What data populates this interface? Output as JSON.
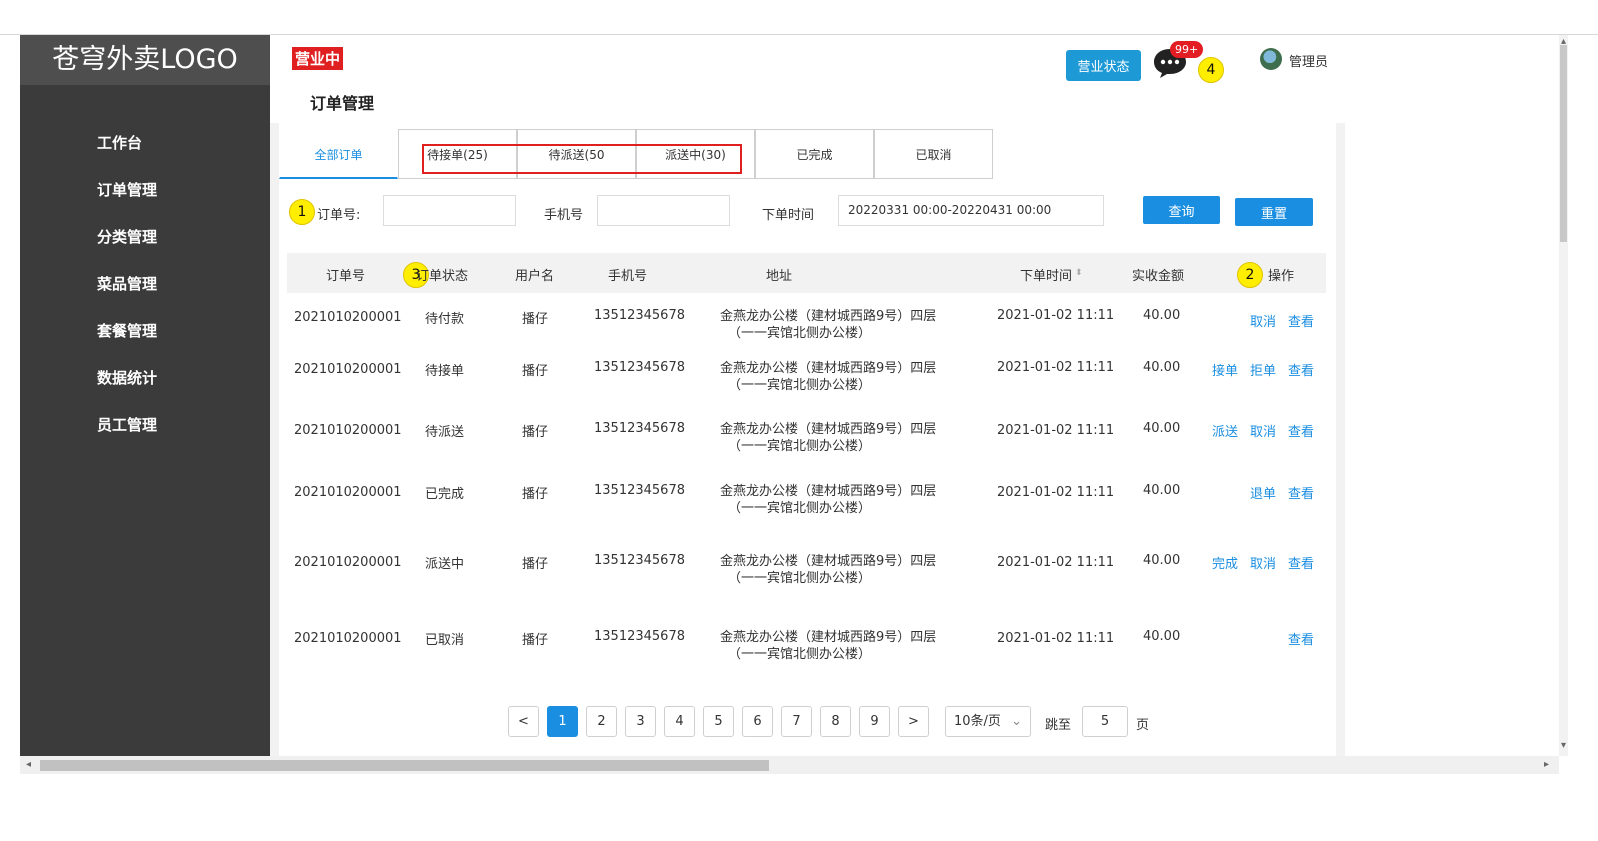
{
  "app": {
    "logo": "苍穹外卖LOGO"
  },
  "sidebar": {
    "items": [
      "工作台",
      "订单管理",
      "分类管理",
      "菜品管理",
      "套餐管理",
      "数据统计",
      "员工管理"
    ]
  },
  "header": {
    "business_status_badge": "营业中",
    "page_title": "订单管理",
    "status_button": "营业状态",
    "message_badge": "99+",
    "admin_name": "管理员"
  },
  "callouts": [
    "1",
    "2",
    "3",
    "4"
  ],
  "tabs": [
    "全部订单",
    "待接单(25)",
    "待派送(50",
    "派送中(30)",
    "已完成",
    "已取消"
  ],
  "filter": {
    "order_no_label": "订单号:",
    "order_no_value": "",
    "phone_label": "手机号",
    "phone_value": "",
    "time_label": "下单时间",
    "time_value": "20220331 00:00-20220431 00:00",
    "query_button": "查询",
    "reset_button": "重置"
  },
  "table": {
    "headers": [
      "订单号",
      "订单状态",
      "用户名",
      "手机号",
      "地址",
      "下单时间",
      "实收金额",
      "操作"
    ],
    "rows": [
      {
        "order_no": "2021010200001",
        "status": "待付款",
        "user": "播仔",
        "phone": "13512345678",
        "addr1": "金燕龙办公楼（建材城西路9号）四层",
        "addr2": "（一一宾馆北侧办公楼）",
        "time": "2021-01-02 11:11",
        "amount": "40.00",
        "actions": [
          "取消",
          "查看"
        ]
      },
      {
        "order_no": "2021010200001",
        "status": "待接单",
        "user": "播仔",
        "phone": "13512345678",
        "addr1": "金燕龙办公楼（建材城西路9号）四层",
        "addr2": "（一一宾馆北侧办公楼）",
        "time": "2021-01-02 11:11",
        "amount": "40.00",
        "actions": [
          "接单",
          "拒单",
          "查看"
        ]
      },
      {
        "order_no": "2021010200001",
        "status": "待派送",
        "user": "播仔",
        "phone": "13512345678",
        "addr1": "金燕龙办公楼（建材城西路9号）四层",
        "addr2": "（一一宾馆北侧办公楼）",
        "time": "2021-01-02 11:11",
        "amount": "40.00",
        "actions": [
          "派送",
          "取消",
          "查看"
        ]
      },
      {
        "order_no": "2021010200001",
        "status": "已完成",
        "user": "播仔",
        "phone": "13512345678",
        "addr1": "金燕龙办公楼（建材城西路9号）四层",
        "addr2": "（一一宾馆北侧办公楼）",
        "time": "2021-01-02 11:11",
        "amount": "40.00",
        "actions": [
          "退单",
          "查看"
        ]
      },
      {
        "order_no": "2021010200001",
        "status": "派送中",
        "user": "播仔",
        "phone": "13512345678",
        "addr1": "金燕龙办公楼（建材城西路9号）四层",
        "addr2": "（一一宾馆北侧办公楼）",
        "time": "2021-01-02 11:11",
        "amount": "40.00",
        "actions": [
          "完成",
          "取消",
          "查看"
        ]
      },
      {
        "order_no": "2021010200001",
        "status": "已取消",
        "user": "播仔",
        "phone": "13512345678",
        "addr1": "金燕龙办公楼（建材城西路9号）四层",
        "addr2": "（一一宾馆北侧办公楼）",
        "time": "2021-01-02 11:11",
        "amount": "40.00",
        "actions": [
          "查看"
        ]
      }
    ]
  },
  "pagination": {
    "prev": "<",
    "next": ">",
    "pages": [
      "1",
      "2",
      "3",
      "4",
      "5",
      "6",
      "7",
      "8",
      "9"
    ],
    "current": "1",
    "page_size": "10条/页",
    "jump_label": "跳至",
    "jump_value": "5",
    "page_suffix": "页"
  },
  "colors": {
    "accent": "#1a8ee0",
    "sidebar": "#3b3b3b",
    "badge_red": "#e02020",
    "callout": "#ffee00"
  }
}
